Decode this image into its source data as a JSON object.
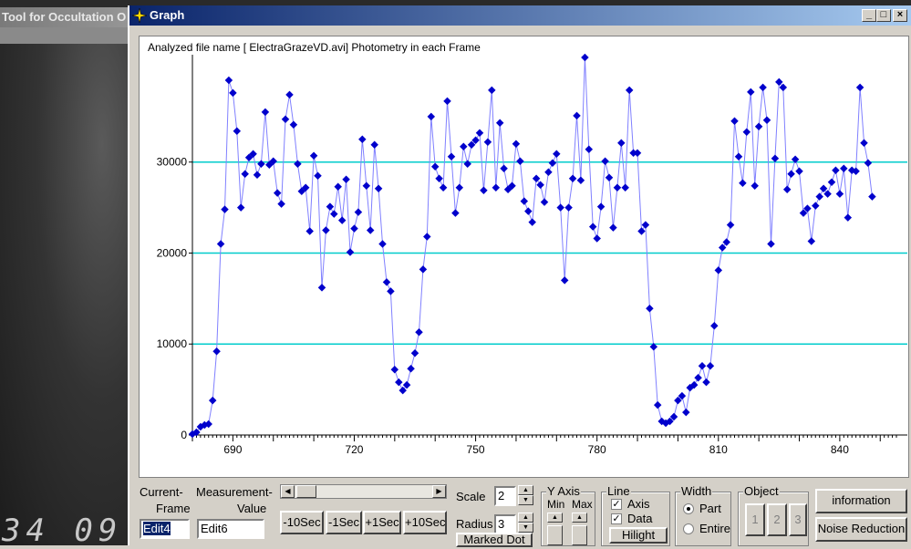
{
  "background_window": {
    "title": "Tool for Occultation O",
    "timestamp": "34 09"
  },
  "graph_window": {
    "title": "Graph",
    "controls": {
      "minimize": "_",
      "maximize": "□",
      "close": "×"
    }
  },
  "colors": {
    "data": "#0000cc",
    "line": "#8080ff",
    "grid": "#00cccc",
    "titlebar": "#0a246a"
  },
  "chart_data": {
    "type": "line",
    "title": "Analyzed file name [ ElectraGrazeVD.avi]   Photometry in each Frame",
    "xlabel": "",
    "ylabel": "",
    "xlim": [
      680,
      854
    ],
    "ylim": [
      0,
      41000
    ],
    "x_ticks": [
      "690",
      "720",
      "750",
      "780",
      "810",
      "840"
    ],
    "y_ticks": [
      "0",
      "10000",
      "20000",
      "30000"
    ],
    "grid": "horizontal lines at 10000, 20000, 30000",
    "series": [
      {
        "x_start": 680,
        "values": [
          100,
          300,
          900,
          1100,
          1200,
          3800,
          9200,
          21000,
          24800,
          39000,
          37600,
          33400,
          25000,
          28700,
          30500,
          30900,
          28600,
          29800,
          35500,
          29700,
          30100,
          26600,
          25400,
          34700,
          37400,
          34100,
          29800,
          26800,
          27200,
          22400,
          30700,
          28500,
          16200,
          22500,
          25100,
          24300,
          27300,
          23600,
          28100,
          20100,
          22700,
          24500,
          32500,
          27400,
          22500,
          31900,
          27100,
          21000,
          16800,
          15800,
          7200,
          5800,
          4900,
          5500,
          7300,
          9000,
          11300,
          18200,
          21800,
          35000,
          29500,
          28200,
          27200,
          36700,
          30600,
          24400,
          27200,
          31700,
          29800,
          31900,
          32400,
          33200,
          26900,
          32200,
          37900,
          27200,
          34300,
          29300,
          27000,
          27400,
          32000,
          30100,
          25700,
          24600,
          23400,
          28200,
          27500,
          25600,
          28900,
          29900,
          30900,
          25000,
          17000,
          25000,
          28200,
          35100,
          28000,
          41500,
          31400,
          22900,
          21600,
          25100,
          30100,
          28300,
          22800,
          27200,
          32100,
          27200,
          37900,
          31000,
          31000,
          22400,
          23100,
          13900,
          9700,
          3300,
          1500,
          1300,
          1500,
          2000,
          3800,
          4300,
          2500,
          5200,
          5500,
          6300,
          7600,
          5800,
          7600,
          12000,
          18100,
          20600,
          21200,
          23100,
          34500,
          30600,
          27700,
          33300,
          37700,
          27400,
          33900,
          38200,
          34600,
          21000,
          30400,
          38800,
          38200,
          27000,
          28700,
          30300,
          29000,
          24400,
          24900,
          21300,
          25200,
          26200,
          27100,
          26500,
          27800,
          29100,
          26500,
          29300,
          23900,
          29100,
          29000,
          38200,
          32100,
          29900,
          26200
        ]
      }
    ]
  },
  "bottom": {
    "current_frame_label_1": "Current-",
    "current_frame_label_2": "Frame",
    "current_frame_value": "Edit4",
    "measurement_label_1": "Measurement-",
    "measurement_label_2": "Value",
    "measurement_value": "Edit6",
    "nav_buttons": [
      "-10Sec",
      "-1Sec",
      "+1Sec",
      "+10Sec"
    ],
    "scale_label": "Scale",
    "scale_value": "2",
    "radius_label": "Radius",
    "radius_value": "3",
    "marked_dot": "Marked Dot",
    "y_axis_caption": "Y Axis",
    "y_axis_min": "Min",
    "y_axis_max": "Max",
    "line_caption": "Line",
    "axis_label": "Axis",
    "data_label": "Data",
    "hilight": "Hilight",
    "width_caption": "Width",
    "part_label": "Part",
    "entire_label": "Entire",
    "object_caption": "Object",
    "object_buttons": [
      "1",
      "2",
      "3"
    ],
    "information": "information",
    "noise_reduction": "Noise Reduction"
  }
}
